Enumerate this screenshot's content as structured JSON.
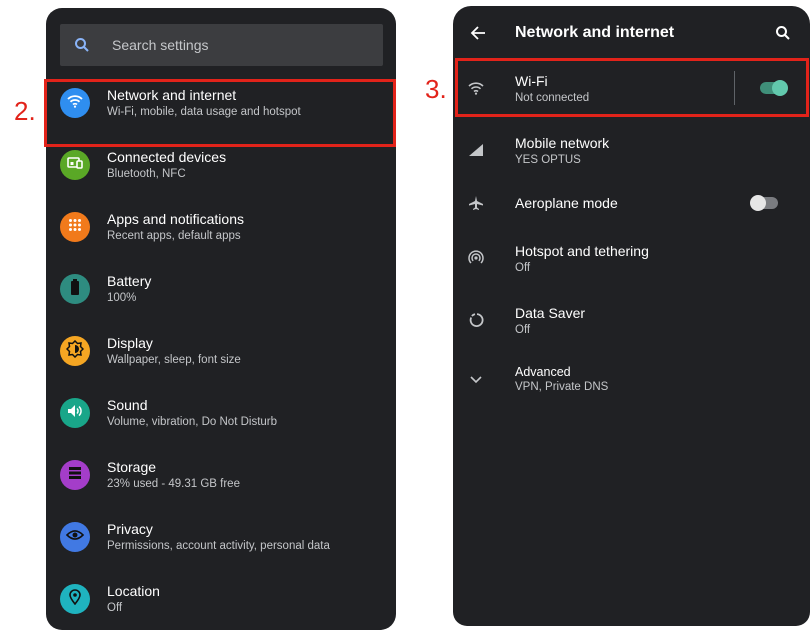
{
  "colors": {
    "background": "#ffffff",
    "phone_bg": "#202124",
    "search_bg": "#3c3d40",
    "callout_red": "#e2231a",
    "toggle_on": "#62c9ad",
    "toggle_off": "#c4c6c9"
  },
  "left_screen": {
    "search_placeholder": "Search settings",
    "step_label": "2.",
    "items": [
      {
        "title": "Network and internet",
        "subtitle": "Wi-Fi, mobile, data usage and hotspot",
        "icon": "wifi-icon",
        "color": "#2f8ef0"
      },
      {
        "title": "Connected devices",
        "subtitle": "Bluetooth, NFC",
        "icon": "connected-devices-icon",
        "color": "#5aa826"
      },
      {
        "title": "Apps and notifications",
        "subtitle": "Recent apps, default apps",
        "icon": "apps-grid-icon",
        "color": "#f17a1b"
      },
      {
        "title": "Battery",
        "subtitle": "100%",
        "icon": "battery-icon",
        "color": "#2e8c80"
      },
      {
        "title": "Display",
        "subtitle": "Wallpaper, sleep, font size",
        "icon": "brightness-icon",
        "color": "#f5a623"
      },
      {
        "title": "Sound",
        "subtitle": "Volume, vibration, Do Not Disturb",
        "icon": "volume-icon",
        "color": "#19a689"
      },
      {
        "title": "Storage",
        "subtitle": "23% used - 49.31 GB free",
        "icon": "storage-icon",
        "color": "#a43dc9"
      },
      {
        "title": "Privacy",
        "subtitle": "Permissions, account activity, personal data",
        "icon": "privacy-eye-icon",
        "color": "#4179e3"
      },
      {
        "title": "Location",
        "subtitle": "Off",
        "icon": "location-pin-icon",
        "color": "#1fb3bf"
      }
    ]
  },
  "right_screen": {
    "header_title": "Network and internet",
    "step_label": "3.",
    "items": [
      {
        "title": "Wi-Fi",
        "subtitle": "Not connected",
        "icon": "wifi-icon",
        "toggle": "on"
      },
      {
        "title": "Mobile network",
        "subtitle": "YES OPTUS",
        "icon": "signal-icon"
      },
      {
        "title": "Aeroplane mode",
        "subtitle": "",
        "icon": "airplane-icon",
        "toggle": "off"
      },
      {
        "title": "Hotspot and tethering",
        "subtitle": "Off",
        "icon": "hotspot-icon"
      },
      {
        "title": "Data Saver",
        "subtitle": "Off",
        "icon": "data-saver-icon"
      },
      {
        "title": "Advanced",
        "subtitle": "VPN, Private DNS",
        "icon": "chevron-down-icon"
      }
    ]
  }
}
